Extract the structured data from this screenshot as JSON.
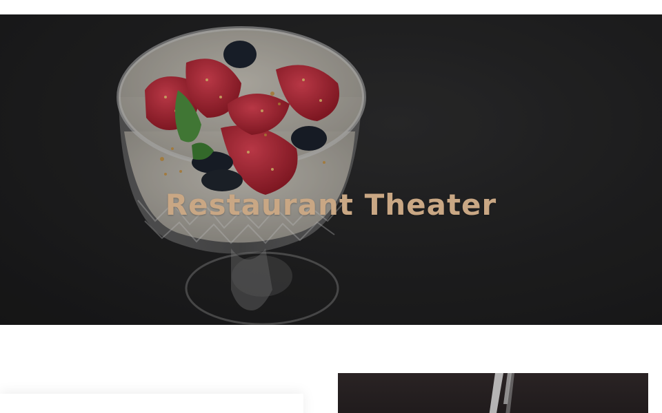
{
  "hero": {
    "title": "Restaurant Theater",
    "image_subject": "dessert-glass-image",
    "title_color": "#c9a784"
  },
  "sections": {
    "left_card": "content-card",
    "right_image": "dish-photo"
  }
}
